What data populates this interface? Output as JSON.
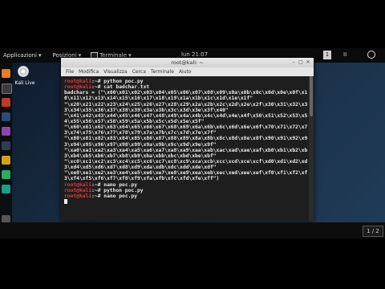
{
  "topbar": {
    "applications": "Applicazioni",
    "places": "Posizioni",
    "terminal": "Terminale",
    "clock": "lun 21.07",
    "badge": "1",
    "indicator": "II"
  },
  "desktop": {
    "disc_label": "Kali Live"
  },
  "window": {
    "title": "root@kali: ~",
    "menu": [
      "File",
      "Modifica",
      "Visualizza",
      "Cerca",
      "Terminale",
      "Aiuto"
    ]
  },
  "terminal": {
    "prompt": "root@kali",
    "lines": [
      {
        "p": "root@kali",
        "t": ":~# python poc.py"
      },
      {
        "p": "root@kali",
        "t": ":~# cat badchar.txt"
      },
      {
        "p": "",
        "t": "badchars = (\"\\x00\\x01\\x02\\x03\\x04\\x05\\x06\\x07\\x08\\x09\\x0a\\x0b\\x0c\\x0d\\x0e\\x0f\\x1"
      },
      {
        "p": "",
        "t": "0\\x11\\x12\\x13\\x14\\x15\\x16\\x17\\x18\\x19\\x1a\\x1b\\x1c\\x1d\\x1e\\x1f\""
      },
      {
        "p": "",
        "t": "\"\\x20\\x21\\x22\\x23\\x24\\x25\\x26\\x27\\x28\\x29\\x2a\\x2b\\x2c\\x2d\\x2e\\x2f\\x30\\x31\\x32\\x3"
      },
      {
        "p": "",
        "t": "3\\x34\\x35\\x36\\x37\\x38\\x39\\x3a\\x3b\\x3c\\x3d\\x3e\\x3f\\x40\""
      },
      {
        "p": "",
        "t": "\"\\x41\\x42\\x43\\x44\\x45\\x46\\x47\\x48\\x49\\x4a\\x4b\\x4c\\x4d\\x4e\\x4f\\x50\\x51\\x52\\x53\\x5"
      },
      {
        "p": "",
        "t": "4\\x55\\x56\\x57\\x58\\x59\\x5a\\x5b\\x5c\\x5d\\x5e\\x5f\""
      },
      {
        "p": "",
        "t": "\"\\x60\\x61\\x62\\x63\\x64\\x65\\x66\\x67\\x68\\x69\\x6a\\x6b\\x6c\\x6d\\x6e\\x6f\\x70\\x71\\x72\\x7"
      },
      {
        "p": "",
        "t": "3\\x74\\x75\\x76\\x77\\x78\\x79\\x7a\\x7b\\x7c\\x7d\\x7e\\x7f\""
      },
      {
        "p": "",
        "t": "\"\\x80\\x81\\x82\\x83\\x84\\x85\\x86\\x87\\x88\\x89\\x8a\\x8b\\x8c\\x8d\\x8e\\x8f\\x90\\x91\\x92\\x9"
      },
      {
        "p": "",
        "t": "3\\x94\\x95\\x96\\x97\\x98\\x99\\x9a\\x9b\\x9c\\x9d\\x9e\\x9f\""
      },
      {
        "p": "",
        "t": "\"\\xa0\\xa1\\xa2\\xa3\\xa4\\xa5\\xa6\\xa7\\xa8\\xa9\\xaa\\xab\\xac\\xad\\xae\\xaf\\xb0\\xb1\\xb2\\xb"
      },
      {
        "p": "",
        "t": "3\\xb4\\xb5\\xb6\\xb7\\xb8\\xb9\\xba\\xbb\\xbc\\xbd\\xbe\\xbf\""
      },
      {
        "p": "",
        "t": "\"\\xc0\\xc1\\xc2\\xc3\\xc4\\xc5\\xc6\\xc7\\xc8\\xc9\\xca\\xcb\\xcc\\xcd\\xce\\xcf\\xd0\\xd1\\xd2\\xd"
      },
      {
        "p": "",
        "t": "3\\xd4\\xd5\\xd6\\xd7\\xd8\\xd9\\xda\\xdb\\xdc\\xdd\\xde\\xdf\""
      },
      {
        "p": "",
        "t": "\"\\xe0\\xe1\\xe2\\xe3\\xe4\\xe5\\xe6\\xe7\\xe8\\xe9\\xea\\xeb\\xec\\xed\\xee\\xef\\xf0\\xf1\\xf2\\xf"
      },
      {
        "p": "",
        "t": "3\\xf4\\xf5\\xf6\\xf7\\xf8\\xf9\\xfa\\xfb\\xfc\\xfd\\xfe\\xff\")"
      },
      {
        "p": "root@kali",
        "t": ":~# nano poc.py"
      },
      {
        "p": "root@kali",
        "t": ":~# python poc.py"
      },
      {
        "p": "root@kali",
        "t": ":~# nano poc.py"
      },
      {
        "p": "",
        "t": ""
      }
    ]
  },
  "workspace": "1 / 2",
  "colors": {
    "prompt": "#e43b3b",
    "terminal_bg": "#1e1e1e",
    "desktop_bg": "#1b3148"
  },
  "icons": [
    "applications-icon",
    "places-icon",
    "terminal-icon",
    "power-icon",
    "kali-disc-icon"
  ]
}
